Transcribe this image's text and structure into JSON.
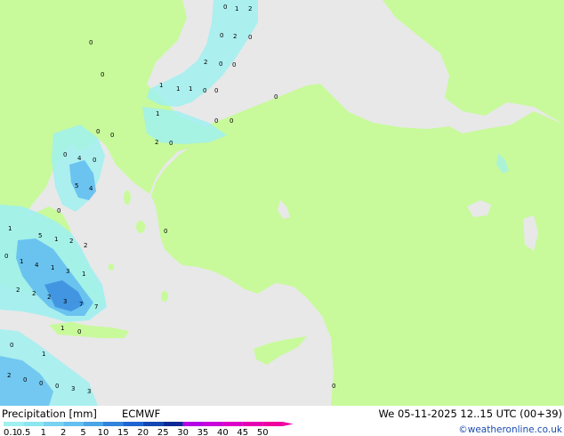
{
  "title": "Precipitation [mm]",
  "model": "ECMWF",
  "valid_time": "We 05-11-2025 12..15 UTC (00+39)",
  "credit": "©weatheronline.co.uk",
  "legend": {
    "labels": [
      "0.1",
      "0.5",
      "1",
      "2",
      "5",
      "10",
      "15",
      "20",
      "25",
      "30",
      "35",
      "40",
      "45",
      "50"
    ],
    "colors": [
      "#a0f0f0",
      "#8ce6f0",
      "#78d2f0",
      "#64bef0",
      "#4aa5e6",
      "#3283dc",
      "#1e64d2",
      "#1446b4",
      "#0a2896",
      "#b400e6",
      "#c800dc",
      "#dc00c8",
      "#e600b4",
      "#f000a0"
    ]
  },
  "colors": {
    "land": "#c8fa9b",
    "sea": "#e8e8e8",
    "light_precip": "#a0f0f0",
    "moderate_precip": "#64bef0",
    "heavy_precip": "#3283dc"
  },
  "grid_values": [
    {
      "label": "0"
    },
    {
      "label": "1"
    },
    {
      "label": "2"
    },
    {
      "label": "0"
    },
    {
      "label": "2"
    },
    {
      "label": "0"
    },
    {
      "label": "0"
    },
    {
      "label": "2"
    },
    {
      "label": "0"
    },
    {
      "label": "0"
    },
    {
      "label": "0"
    },
    {
      "label": "1"
    },
    {
      "label": "1"
    },
    {
      "label": "1"
    },
    {
      "label": "0"
    },
    {
      "label": "0"
    },
    {
      "label": "1"
    },
    {
      "label": "0"
    },
    {
      "label": "0"
    },
    {
      "label": "0"
    },
    {
      "label": "0"
    },
    {
      "label": "2"
    },
    {
      "label": "0"
    },
    {
      "label": "0"
    },
    {
      "label": "4"
    },
    {
      "label": "0"
    },
    {
      "label": "5"
    },
    {
      "label": "4"
    },
    {
      "label": "0"
    },
    {
      "label": "0"
    },
    {
      "label": "1"
    },
    {
      "label": "5"
    },
    {
      "label": "1"
    },
    {
      "label": "2"
    },
    {
      "label": "2"
    },
    {
      "label": "0"
    },
    {
      "label": "1"
    },
    {
      "label": "4"
    },
    {
      "label": "1"
    },
    {
      "label": "3"
    },
    {
      "label": "1"
    },
    {
      "label": "2"
    },
    {
      "label": "2"
    },
    {
      "label": "2"
    },
    {
      "label": "3"
    },
    {
      "label": "7"
    },
    {
      "label": "7"
    },
    {
      "label": "1"
    },
    {
      "label": "0"
    },
    {
      "label": "0"
    },
    {
      "label": "1"
    },
    {
      "label": "2"
    },
    {
      "label": "0"
    },
    {
      "label": "0"
    },
    {
      "label": "0"
    },
    {
      "label": "3"
    },
    {
      "label": "3"
    },
    {
      "label": "0"
    },
    {
      "label": "0"
    }
  ]
}
